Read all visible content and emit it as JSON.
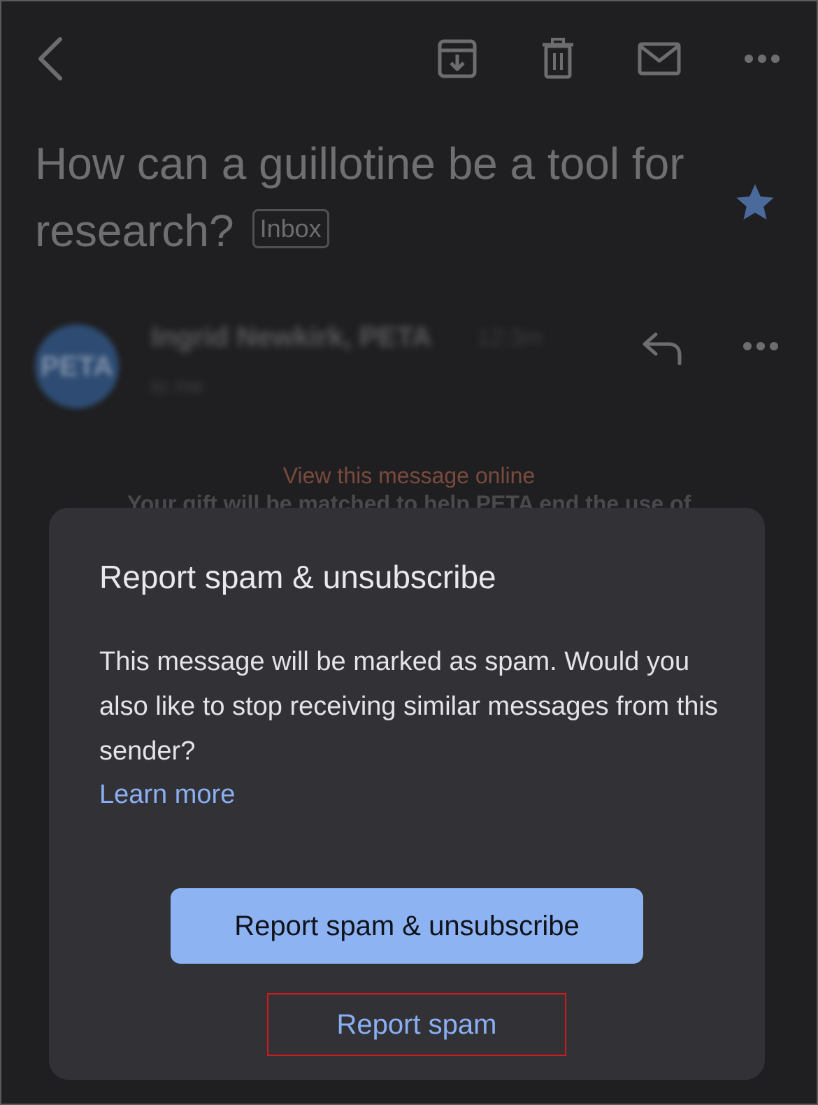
{
  "toolbar": {
    "back_icon": "chevron-left-icon",
    "archive_icon": "archive-icon",
    "delete_icon": "trash-icon",
    "mark_unread_icon": "mail-icon",
    "more_icon": "more-horizontal-icon"
  },
  "email": {
    "subject": "How can a guillotine be a tool for research?",
    "label": "Inbox",
    "starred": true,
    "sender": {
      "avatar_text": "PETA",
      "name": "Ingrid Newkirk, PETA",
      "time": "12:3m",
      "to": "to me"
    },
    "view_online": "View this message online",
    "body_peek": "Your gift will be matched to help PETA end the use of"
  },
  "dialog": {
    "title": "Report spam & unsubscribe",
    "body": "This message will be marked as spam. Would you also like to stop receiving similar messages from this sender?",
    "learn_more": "Learn more",
    "primary_button": "Report spam & unsubscribe",
    "secondary_button": "Report spam"
  },
  "colors": {
    "background": "#1f1f21",
    "dialog": "#323236",
    "accent": "#8ab0f3",
    "primary_button": "#8eb3f3",
    "star": "#4a6a9c",
    "highlight_border": "#d11a1a"
  }
}
